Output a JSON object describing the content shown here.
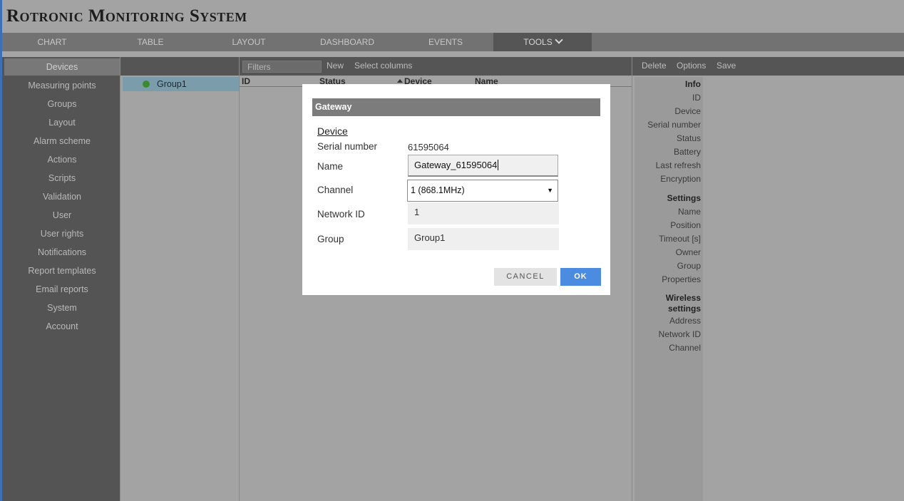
{
  "app": {
    "title": "Rotronic Monitoring System"
  },
  "nav": {
    "tabs": [
      {
        "label": "CHART"
      },
      {
        "label": "TABLE"
      },
      {
        "label": "LAYOUT"
      },
      {
        "label": "DASHBOARD"
      },
      {
        "label": "EVENTS"
      },
      {
        "label": "TOOLS",
        "active": true,
        "icon": "chevron-down-icon"
      }
    ]
  },
  "sidebar": {
    "items": [
      {
        "label": "Devices",
        "active": true
      },
      {
        "label": "Measuring points"
      },
      {
        "label": "Groups"
      },
      {
        "label": "Layout"
      },
      {
        "label": "Alarm scheme"
      },
      {
        "label": "Actions"
      },
      {
        "label": "Scripts"
      },
      {
        "label": "Validation"
      },
      {
        "label": "User"
      },
      {
        "label": "User rights"
      },
      {
        "label": "Notifications"
      },
      {
        "label": "Report templates"
      },
      {
        "label": "Email reports"
      },
      {
        "label": "System"
      },
      {
        "label": "Account"
      }
    ]
  },
  "groups": {
    "items": [
      {
        "label": "Group1",
        "status_color": "#3a8a2f"
      }
    ]
  },
  "main": {
    "filter_placeholder": "Filters",
    "new_label": "New",
    "select_columns_label": "Select columns",
    "columns": [
      "ID",
      "Status",
      "Device",
      "Name"
    ],
    "sorted_column": "Device"
  },
  "detail": {
    "toolbar": {
      "delete": "Delete",
      "options": "Options",
      "save": "Save"
    },
    "info_heading": "Info",
    "info_fields": [
      "ID",
      "Device",
      "Serial number",
      "Status",
      "Battery",
      "Last refresh",
      "Encryption"
    ],
    "settings_heading": "Settings",
    "settings_fields": [
      "Name",
      "Position",
      "Timeout [s]",
      "Owner",
      "Group",
      "Properties"
    ],
    "wireless_heading_1": "Wireless",
    "wireless_heading_2": "settings",
    "wireless_fields": [
      "Address",
      "Network ID",
      "Channel"
    ]
  },
  "dialog": {
    "title": "Gateway",
    "section": "Device",
    "serial_label": "Serial number",
    "serial_value": "61595064",
    "name_label": "Name",
    "name_value": "Gateway_61595064",
    "channel_label": "Channel",
    "channel_value": "1 (868.1MHz)",
    "network_label": "Network ID",
    "network_value": "1",
    "group_label": "Group",
    "group_value": "Group1",
    "cancel_label": "CANCEL",
    "ok_label": "OK"
  },
  "colors": {
    "accent": "#3b6fb6",
    "ok_button": "#4b8be0",
    "status_online": "#3a8a2f"
  }
}
